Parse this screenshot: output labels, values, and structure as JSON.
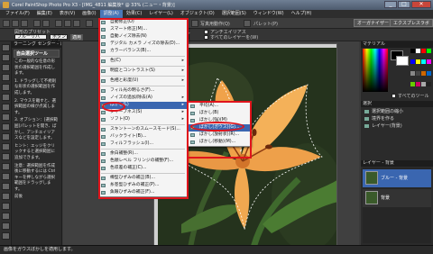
{
  "window": {
    "title": "Corel PaintShop Photo Pro X3 - [IMG_4811 編集後* @ 33% (ニュー・背景)]",
    "minimize": "_",
    "maximize": "□",
    "close": "✕"
  },
  "menubar": {
    "items": [
      "ファイル(F)",
      "編集(E)",
      "表示(V)",
      "画像(I)",
      "調整(A)",
      "効果(C)",
      "レイヤー(L)",
      "オブジェクト(O)",
      "選択範囲(S)",
      "ウィンドウ(W)",
      "ヘルプ(H)"
    ],
    "active_index": 4
  },
  "toolbar1": {
    "pulldown1": "写真用動作(Q)",
    "pulldown2": "パレット(P)",
    "right_buttons": [
      "オーガナイザー",
      "エクスプレスラボ"
    ]
  },
  "toolbar2": {
    "preset_label": "図形のプリセット",
    "preset_value": "フルーリバ",
    "mode_value": "ボタン(ダ",
    "apply": "適用",
    "antialias_label": "アンチエイリアス",
    "all_layers_label": "すべてのレイヤーを(W)",
    "feather_label": "ぼかし"
  },
  "left_panel": {
    "header": "ラーニング センター - 選択ツール",
    "subheader": "自由選択ツール",
    "paragraphs": [
      "この一般的な任意の形状の選択範囲を作成します。",
      "1. ドラッグして不規則な形状の選択範囲を作成します。",
      "2. マウスを離すと、選択範囲の線が点滅します。",
      "3. オプション：[選択範囲]パレットを開き、ぼかし、アンチエイリアスなどを設定します。",
      "ヒント：エッジをクリックすると選択範囲に追加できます。",
      "注意：選択範囲を作成後に移動するには Ctrl キーを押しながら選択範囲をドラッグします。",
      "前後"
    ]
  },
  "adjust_menu": {
    "items": [
      {
        "label": "自動修正(O)"
      },
      {
        "label": "スマート修正(M)..."
      },
      {
        "label": "自動ノイズ除去(N)"
      },
      {
        "label": "デジタル カメラ ノイズの除去(D)..."
      },
      {
        "label": "カラーバランス(B)..."
      },
      {
        "sep": true
      },
      {
        "label": "色(C)",
        "sub": true
      },
      {
        "sep": true
      },
      {
        "label": "明度とコントラスト(S)",
        "sub": true
      },
      {
        "sep": true
      },
      {
        "label": "色相と彩度(U)",
        "sub": true
      },
      {
        "sep": true
      },
      {
        "label": "フィル光の明るさ(F)..."
      },
      {
        "label": "ノイズの追加/除去(A)",
        "sub": true
      },
      {
        "label": "ぼかし(L)",
        "sub": true,
        "hl": true
      },
      {
        "label": "シャープネス(S)",
        "sub": true
      },
      {
        "label": "ソフト(O)",
        "sub": true
      },
      {
        "sep": true
      },
      {
        "label": "スキントーンのスムースモード(S)..."
      },
      {
        "label": "バックライト(B)..."
      },
      {
        "label": "フィルフラッシュ(I)..."
      },
      {
        "sep": true
      },
      {
        "label": "余白補整(R)..."
      },
      {
        "label": "色順レベル フリンジの補整(F)..."
      },
      {
        "label": "色収差の補正(C)..."
      },
      {
        "sep": true
      },
      {
        "label": "樽型ひずみの補正(B)..."
      },
      {
        "label": "糸巻型ひずみの補正(P)..."
      },
      {
        "label": "魚眼ひずみの補正(F)..."
      }
    ]
  },
  "blur_submenu": {
    "items": [
      {
        "label": "平均(A)..."
      },
      {
        "label": "ぼかし(B)"
      },
      {
        "label": "ぼかし(強)(M)"
      },
      {
        "label": "ぼかし(ガウス)(G)...",
        "hl": true
      },
      {
        "label": "ぼかし(放射状)(R)..."
      },
      {
        "label": "ぼかし(移動)(M)..."
      }
    ]
  },
  "right_panel": {
    "material_header": "マテリアル",
    "all_tools_label": "すべてのツール",
    "layers_small_header": "選択",
    "layers_small_items": [
      "選択範囲の縮小",
      "境界を作る",
      "レイヤー(背景)"
    ],
    "layers_header": "レイヤー - 背景",
    "layer_items": [
      "ブルー - 背景",
      "背景"
    ]
  },
  "status": {
    "text": "画像をガウスぼかしを適用します。"
  },
  "colors": {
    "accent": "#3a66b0",
    "highlight": "#e0141c",
    "swatch_fg": "#000000",
    "swatch_bg": "#ffffff"
  }
}
